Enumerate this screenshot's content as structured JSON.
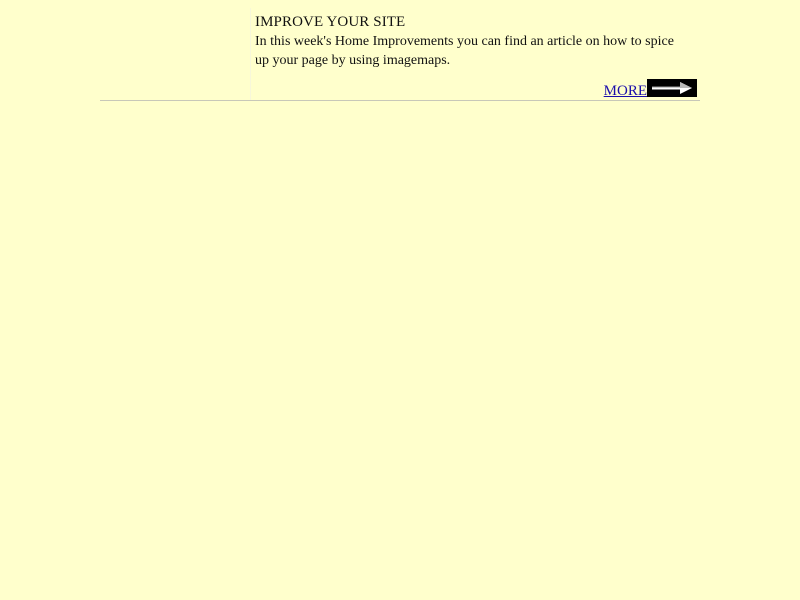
{
  "article": {
    "headline": "IMPROVE YOUR SITE",
    "body": "In this week's Home Improvements you can find an article on how to spice up your page by using imagemaps.",
    "more_label": "MORE",
    "arrow_icon": "right-arrow-icon"
  },
  "colors": {
    "background": "#ffffcc",
    "link": "#1a0dab",
    "arrow_box": "#000000"
  }
}
